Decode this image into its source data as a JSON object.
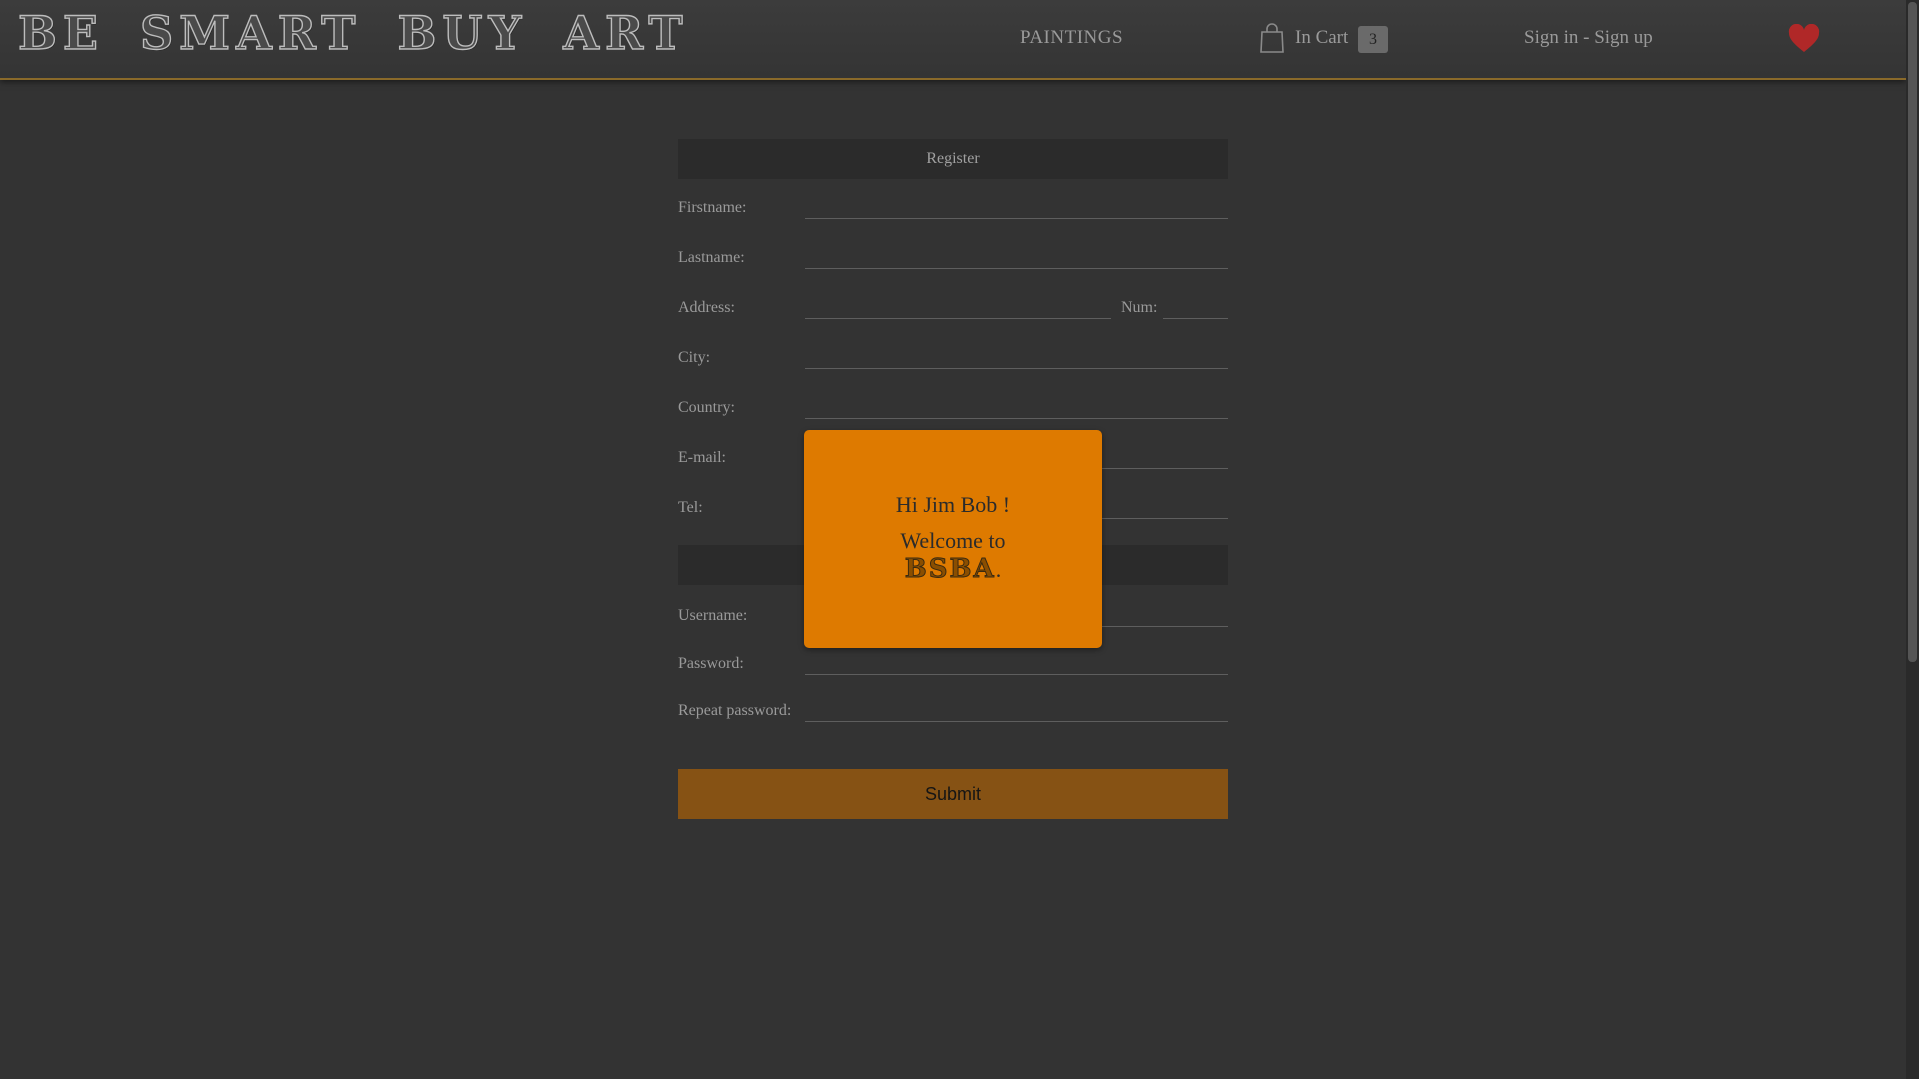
{
  "header": {
    "logo": "BE SMART BUY ART",
    "nav": {
      "paintings": "PAINTINGS",
      "cart_label": "In Cart",
      "cart_count": "3",
      "signin": "Sign in - Sign up"
    },
    "icons": {
      "cart": "shopping-bag-icon",
      "favorites": "heart-icon"
    },
    "colors": {
      "accent_border": "#8a6a2a",
      "heart": "#b02828"
    }
  },
  "form": {
    "register_title": "Register",
    "fields": {
      "firstname": "Firstname:",
      "lastname": "Lastname:",
      "address": "Address:",
      "num": "Num:",
      "city": "City:",
      "country": "Country:",
      "email": "E-mail:",
      "tel": "Tel:",
      "username": "Username:",
      "password": "Password:",
      "repeat_password": "Repeat password:"
    },
    "submit_label": "Submit",
    "colors": {
      "submit_bg": "#865214",
      "section_bg": "#2b2b2b"
    }
  },
  "popup": {
    "greeting": "Hi Jim Bob !",
    "welcome": "Welcome to",
    "brand": "BSBA",
    "brand_suffix": ".",
    "color": "#de7a00"
  }
}
